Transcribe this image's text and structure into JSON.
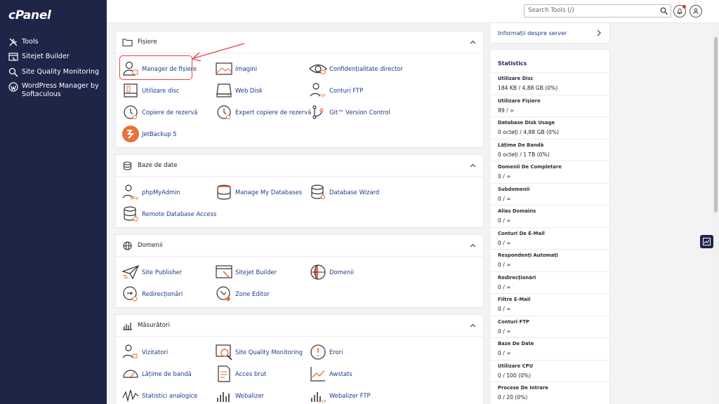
{
  "app": {
    "logo": "cPanel"
  },
  "sidebar": {
    "items": [
      {
        "label": "Tools",
        "icon": "tools-icon"
      },
      {
        "label": "Sitejet Builder",
        "icon": "sitejet-icon"
      },
      {
        "label": "Site Quality Monitoring",
        "icon": "magnifier-icon"
      },
      {
        "label": "WordPress Manager by Softaculous",
        "icon": "wordpress-icon"
      }
    ]
  },
  "header": {
    "search_placeholder": "Search Tools (/)"
  },
  "sections": {
    "fisiere": {
      "title": "Fișiere",
      "tools": [
        "Manager de fișiere",
        "Imagini",
        "Confidențialitate director",
        "Utilizare disc",
        "Web Disk",
        "Conturi FTP",
        "Copiere de rezervă",
        "Expert copiere de rezervă",
        "Git™ Version Control",
        "JetBackup 5"
      ]
    },
    "baze": {
      "title": "Baze de date",
      "tools": [
        "phpMyAdmin",
        "Manage My Databases",
        "Database Wizard",
        "Remote Database Access"
      ]
    },
    "domenii": {
      "title": "Domenii",
      "tools": [
        "Site Publisher",
        "Sitejet Builder",
        "Domenii",
        "Redirecționări",
        "Zone Editor"
      ]
    },
    "masuratori": {
      "title": "Măsurători",
      "tools": [
        "Vizitatori",
        "Site Quality Monitoring",
        "Erori",
        "Lățime de bandă",
        "Acces brut",
        "Awstats",
        "Statistici analogice",
        "Webalizer",
        "Webalizer FTP"
      ]
    }
  },
  "right": {
    "server_info": "Informații despre server",
    "stats_title": "Statistics",
    "stats": [
      {
        "label": "Utilizare Disc",
        "value": "184 KB / 4,88 GB   (0%)"
      },
      {
        "label": "Utilizare Fișiere",
        "value": "89 / ∞"
      },
      {
        "label": "Database Disk Usage",
        "value": "0 octeți / 4,88 GB   (0%)"
      },
      {
        "label": "Lățime De Bandă",
        "value": "0 octeți / 1 TB   (0%)"
      },
      {
        "label": "Domenii De Completare",
        "value": "0 / ∞"
      },
      {
        "label": "Subdomenii",
        "value": "0 / ∞"
      },
      {
        "label": "Alias Domains",
        "value": "0 / ∞"
      },
      {
        "label": "Conturi De E-Mail",
        "value": "0 / ∞"
      },
      {
        "label": "Respondenți Automați",
        "value": "0 / ∞"
      },
      {
        "label": "Redirecționări",
        "value": "0 / ∞"
      },
      {
        "label": "Filtre E-Mail",
        "value": "0 / ∞"
      },
      {
        "label": "Conturi FTP",
        "value": "0 / ∞"
      },
      {
        "label": "Baze De Date",
        "value": "0 / ∞"
      },
      {
        "label": "Utilizare CPU",
        "value": "0 / 100   (0%)"
      },
      {
        "label": "Procese De Intrare",
        "value": "0 / 20   (0%)"
      }
    ]
  },
  "colors": {
    "sidebar": "#1f2547",
    "link": "#1a3a8a",
    "accent": "#e8723a",
    "highlight": "#e0454a"
  }
}
